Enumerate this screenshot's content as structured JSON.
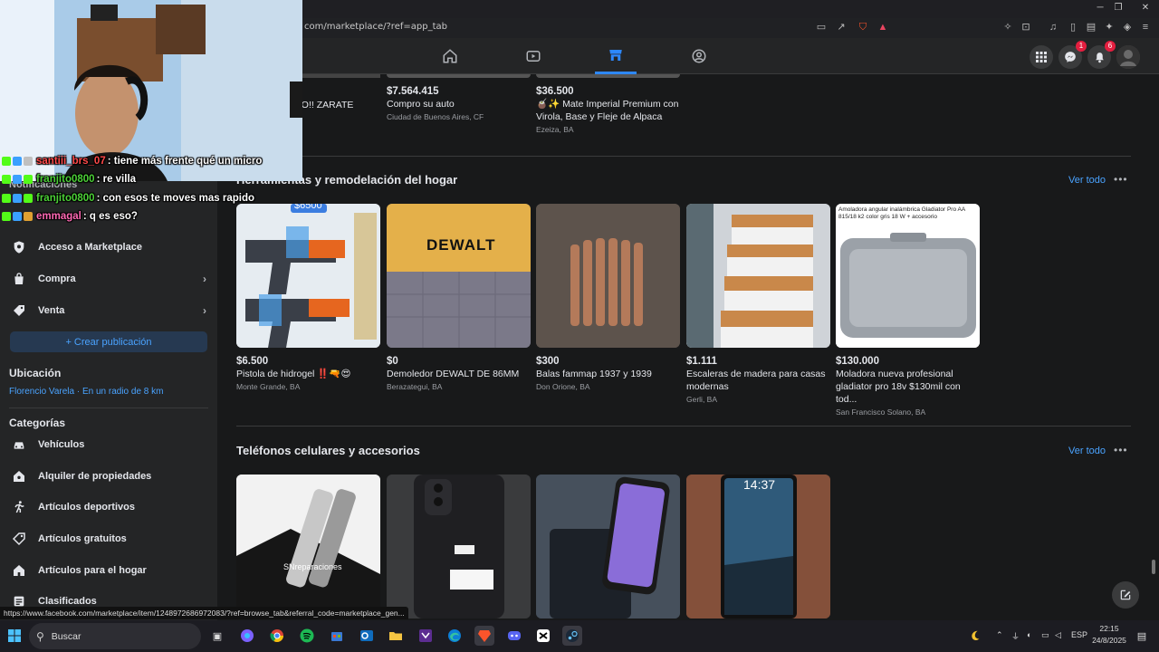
{
  "browser": {
    "url": "com/marketplace/?ref=app_tab"
  },
  "nav": {
    "messenger_badge": "1",
    "notifications_badge": "6"
  },
  "top_row": [
    {
      "title": "AUTO!! ZARATE"
    },
    {
      "price": "$7.564.415",
      "title": "Compro su auto",
      "location": "Ciudad de Buenos Aires, CF"
    },
    {
      "price": "$36.500",
      "title": "🧉✨ Mate Imperial Premium con Virola, Base y Fleje de Alpaca",
      "location": "Ezeiza, BA"
    }
  ],
  "sidebar": {
    "notifications": "Notificaciones",
    "items": [
      {
        "label": "Acceso a Marketplace"
      },
      {
        "label": "Compra"
      },
      {
        "label": "Venta"
      }
    ],
    "create_label": "+ Crear publicación",
    "location_head": "Ubicación",
    "location_value": "Florencio Varela · En un radio de 8 km",
    "categories_head": "Categorías",
    "categories": [
      {
        "label": "Vehículos"
      },
      {
        "label": "Alquiler de propiedades"
      },
      {
        "label": "Artículos deportivos"
      },
      {
        "label": "Artículos gratuitos"
      },
      {
        "label": "Artículos para el hogar"
      },
      {
        "label": "Clasificados"
      }
    ]
  },
  "section1": {
    "title": "Herramientas y remodelación del hogar",
    "ver_todo": "Ver todo",
    "cards": [
      {
        "price": "$6.500",
        "title": "Pistola de hidrogel ‼️🔫😍",
        "location": "Monte Grande, BA",
        "overlay": "$6500"
      },
      {
        "price": "$0",
        "title": "Demoledor DEWALT DE 86MM",
        "location": "Berazategui, BA",
        "overlay": "DEWALT"
      },
      {
        "price": "$300",
        "title": "Balas fammap 1937 y 1939",
        "location": "Don Orione, BA"
      },
      {
        "price": "$1.111",
        "title": "Escaleras de madera para casas modernas",
        "location": "Gerli, BA"
      },
      {
        "price": "$130.000",
        "title": "Moladora nueva profesional gladiator pro 18v $130mil con tod...",
        "location": "San Francisco Solano, BA",
        "overlay": "Amoladora angular inalámbrica Gladiator Pro AA 815/18 k2 color gris 18 W + accesorio"
      }
    ]
  },
  "section2": {
    "title": "Teléfonos celulares y accesorios",
    "ver_todo": "Ver todo",
    "cards": [
      {
        "overlay": "SNreparaciones"
      },
      {},
      {},
      {
        "overlay": "14:37"
      }
    ]
  },
  "chat": [
    {
      "user": "santiii_brs_07",
      "msg": ": tiene más frente qué un micro",
      "color": "#ff4a4a"
    },
    {
      "user": "franjito0800",
      "msg": ": re villa",
      "color": "#4cd137"
    },
    {
      "user": "franjito0800",
      "msg": ": con esos te moves mas rapido",
      "color": "#4cd137"
    },
    {
      "user": "emmagal",
      "msg": ": q es eso?",
      "color": "#ff69b4"
    }
  ],
  "status_link": "https://www.facebook.com/marketplace/item/1248972686972083/?ref=browse_tab&referral_code=marketplace_gen...",
  "taskbar": {
    "search": "Buscar",
    "lang": "ESP",
    "time": "22:15",
    "date": "24/8/2025"
  },
  "colors": {
    "accent": "#2d88ff",
    "link": "#4aa3ff",
    "bg": "#18191a",
    "panel": "#242526"
  }
}
